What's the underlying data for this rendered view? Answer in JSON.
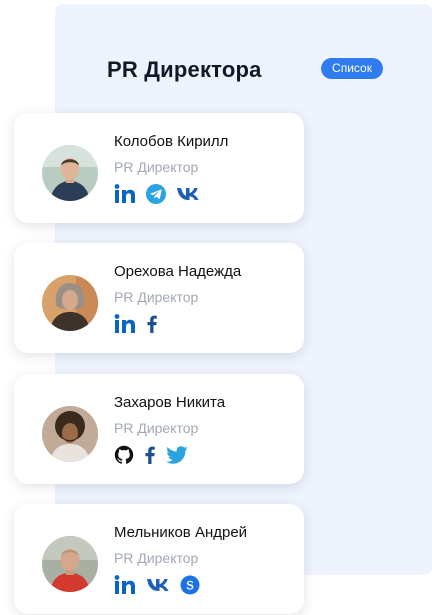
{
  "header": {
    "title": "PR Директора",
    "badge_label": "Список"
  },
  "colors": {
    "accent": "#2f7bf2",
    "panel_bg": "#eef3fd",
    "role_text": "#a2a8b5",
    "linkedin": "#0a66c2",
    "telegram": "#2aa3e0",
    "vk": "#1f5fb4",
    "facebook": "#1d4f91",
    "twitter": "#2aa3e0",
    "skype": "#1f72e6",
    "github": "#111111"
  },
  "people": [
    {
      "name": "Колобов Кирилл",
      "role": "PR Директор",
      "socials": [
        "linkedin-icon",
        "telegram-icon",
        "vk-icon"
      ]
    },
    {
      "name": "Орехова Надежда",
      "role": "PR Директор",
      "socials": [
        "linkedin-icon",
        "facebook-icon"
      ]
    },
    {
      "name": "Захаров Никита",
      "role": "PR Директор",
      "socials": [
        "github-icon",
        "facebook-icon",
        "twitter-icon"
      ]
    },
    {
      "name": "Мельников Андрей",
      "role": "PR Директор",
      "socials": [
        "linkedin-icon",
        "vk-icon",
        "skype-icon"
      ]
    }
  ]
}
